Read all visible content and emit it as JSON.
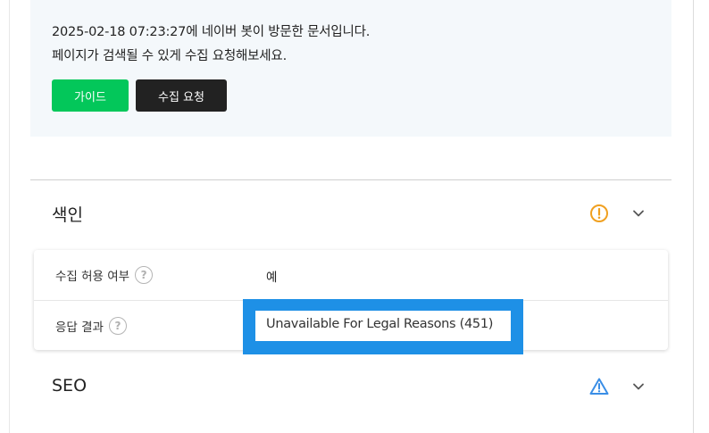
{
  "notice": {
    "line1": "2025-02-18 07:23:27에 네이버 봇이 방문한 문서입니다.",
    "line2": "페이지가 검색될 수 있게 수집 요청해보세요.",
    "guide_button": "가이드",
    "request_button": "수집 요청"
  },
  "index_section": {
    "title": "색인",
    "status_icon": "warning-circle-icon",
    "rows": [
      {
        "label": "수집 허용 여부",
        "value": "예"
      },
      {
        "label": "응답 결과",
        "value": "Unavailable For Legal Reasons (451)"
      }
    ]
  },
  "seo_section": {
    "title": "SEO",
    "status_icon": "warning-triangle-icon"
  },
  "colors": {
    "guide_green": "#03c75a",
    "request_dark": "#222222",
    "notice_bg": "#f4f8fb",
    "warning_orange": "#f0a020",
    "warning_blue": "#3a8ee6",
    "highlight_blue": "#1e90e6"
  }
}
